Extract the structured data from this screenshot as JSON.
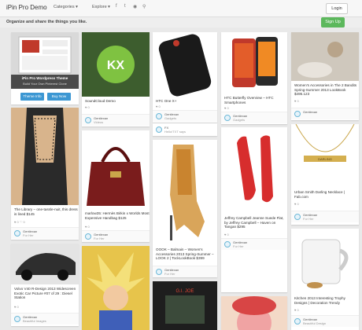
{
  "header": {
    "brand": "iPin Pro Demo",
    "menu_categories": "Categories ▾",
    "menu_explore": "Explore ▾",
    "social_icons": [
      "facebook-icon",
      "twitter-icon",
      "rss-icon",
      "search-icon"
    ],
    "login_label": "Login"
  },
  "subbar": {
    "tagline": "Organize and share the things you like.",
    "signup_label": "Sign Up"
  },
  "promo": {
    "line1": "iPin Pro Wordpress Theme",
    "line2": "Build Your Own Pinterest Clone",
    "theme_info": "Theme Info",
    "buy_now": "Buy Now"
  },
  "pins": [
    {
      "caption": "SoundCloud Demo",
      "stats": "♥ 0",
      "user": "Gentlexan",
      "board": "Videos"
    },
    {
      "caption": "HTC One X+",
      "stats": "♥ 0",
      "user": "Gentlexan",
      "board": "Gadgets"
    },
    {
      "caption": "",
      "stats": "",
      "user": "FX",
      "board": "Hello!TXT says"
    },
    {
      "caption": "HTC Butterfly Overview – HTC Smartphones",
      "stats": "♥ 0",
      "user": "Gentlexan",
      "board": "Gadgets"
    },
    {
      "caption": "Women's Accessories in The 2 Bandits Spring-Summer 2013 LookBook $495.123",
      "stats": "♥ 0",
      "user": "Gentlexan",
      "board": ""
    },
    {
      "caption": "The Library – one-tassle-nuit, this dress is lined $145",
      "stats": "♥ 0  ♡ 0",
      "user": "Gentlexan",
      "board": "For Her"
    },
    {
      "caption": "marlow35: Hermès Birkin x Worlds Most Expensive Handbag $125",
      "stats": "♥ 0",
      "user": "Gentlexan",
      "board": "For Her"
    },
    {
      "caption": "OOOK – Balmain – Women's Accessories 2013 Spring-Summer – LOOK 2 | TockLookBook $399",
      "stats": "♥ 0",
      "user": "Gentlexan",
      "board": "For Her"
    },
    {
      "caption": "Jeffrey Campbell Jeanne Suede Flat, by Jeffrey Campbell – Haven on Tangan $295",
      "stats": "♥ 0",
      "user": "Gentlexan",
      "board": "For Her"
    },
    {
      "caption": "Urban Smith Darling Necklace | Fab.com",
      "stats": "♥ 0",
      "user": "Gentlexan",
      "board": "For Her"
    },
    {
      "caption": "Volvo V40 R-Design 2013 Widescreen Exotic Car Picture #07 of 29 : Diesel Station",
      "stats": "♥ 0",
      "user": "Gentlexan",
      "board": "Beautiful Images"
    },
    {
      "caption": "Kitchen 2013 Interesting Trophy Designs | Decoration Trendy",
      "stats": "♥ 0",
      "user": "Gentlexan",
      "board": "Beautiful Design"
    }
  ],
  "colors": {
    "accent": "#3c97d3",
    "signup": "#5cb85c",
    "background": "#e9e9e9"
  }
}
